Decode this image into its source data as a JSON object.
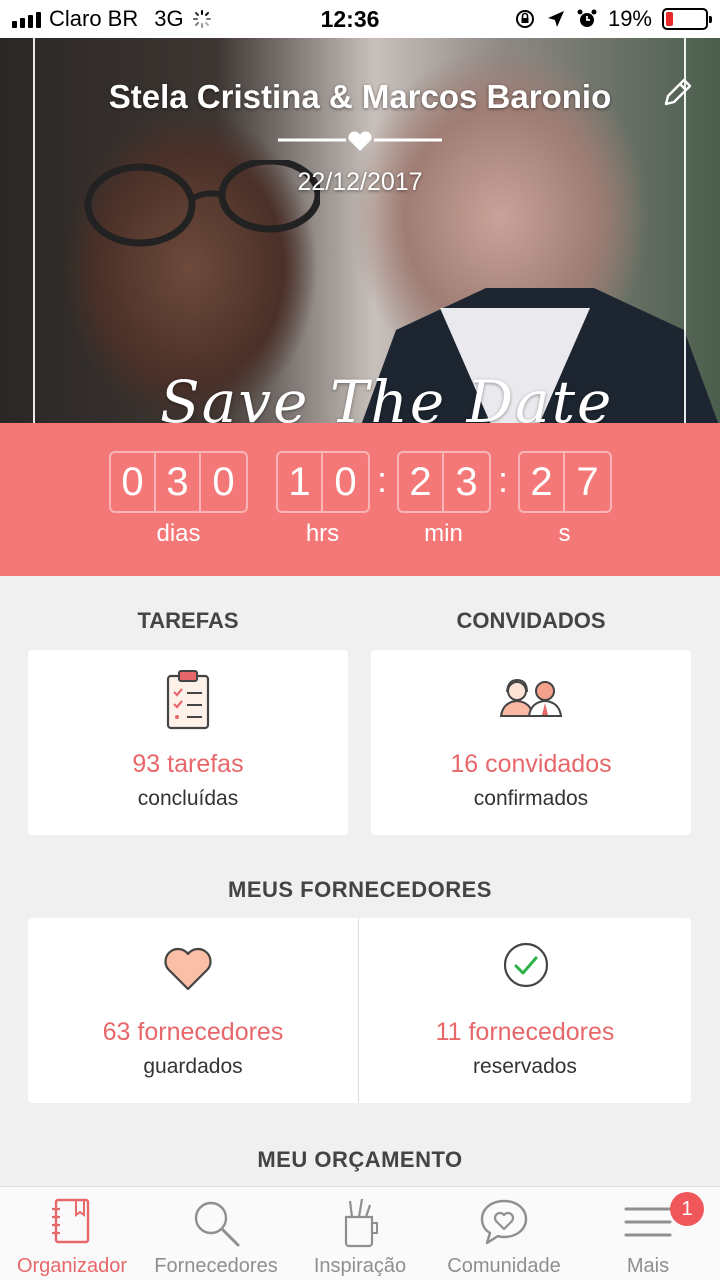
{
  "status_bar": {
    "carrier": "Claro BR",
    "network": "3G",
    "time": "12:36",
    "battery": "19%",
    "battery_level": 0.19
  },
  "hero": {
    "couple_name": "Stela Cristina & Marcos Baronio",
    "date": "22/12/2017",
    "banner_text": "Save The Date"
  },
  "countdown": {
    "days": [
      "0",
      "3",
      "0"
    ],
    "hours": [
      "1",
      "0"
    ],
    "minutes": [
      "2",
      "3"
    ],
    "seconds": [
      "2",
      "7"
    ],
    "labels": {
      "days": "dias",
      "hours": "hrs",
      "minutes": "min",
      "seconds": "s"
    }
  },
  "tasks": {
    "title": "TAREFAS",
    "count": "93 tarefas",
    "sub": "concluídas"
  },
  "guests": {
    "title": "CONVIDADOS",
    "count": "16 convidados",
    "sub": "confirmados"
  },
  "vendors": {
    "title": "MEUS FORNECEDORES",
    "saved_count": "63 fornecedores",
    "saved_sub": "guardados",
    "booked_count": "11 fornecedores",
    "booked_sub": "reservados"
  },
  "budget": {
    "title": "MEU ORÇAMENTO"
  },
  "tabbar": {
    "items": [
      {
        "label": "Organizador",
        "icon": "notebook-icon",
        "active": true
      },
      {
        "label": "Fornecedores",
        "icon": "search-icon",
        "active": false
      },
      {
        "label": "Inspiração",
        "icon": "pencil-cup-icon",
        "active": false
      },
      {
        "label": "Comunidade",
        "icon": "chat-heart-icon",
        "active": false
      },
      {
        "label": "Mais",
        "icon": "menu-icon",
        "active": false
      }
    ],
    "badge": "1"
  },
  "colors": {
    "accent": "#f47878",
    "accent_text": "#e8676a",
    "background": "#f0f0f0"
  }
}
